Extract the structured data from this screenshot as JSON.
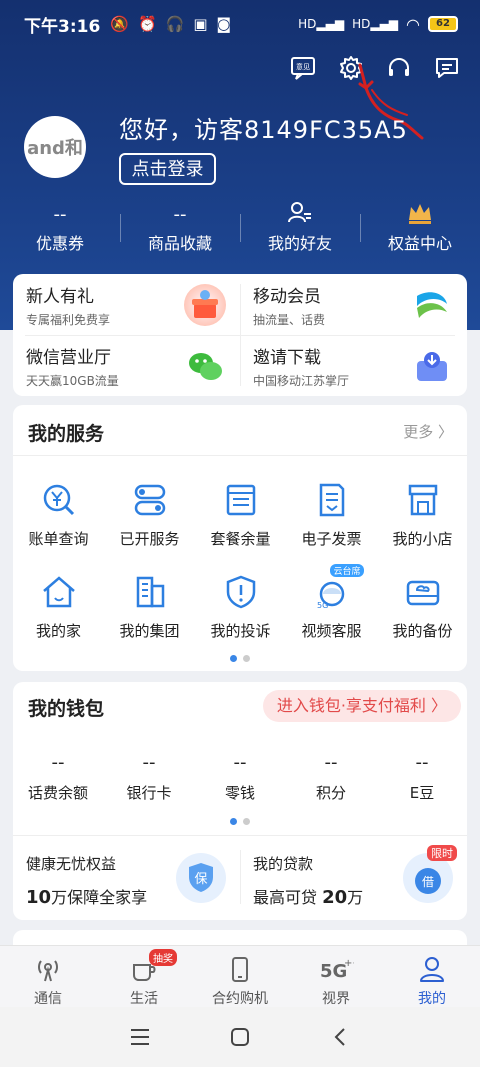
{
  "status_bar": {
    "time": "下午3:16",
    "battery": "62"
  },
  "header": {
    "greeting": "您好，访客8149FC35A5",
    "login_button": "点击登录",
    "avatar_text": "and和"
  },
  "stats": [
    {
      "value": "--",
      "label": "优惠券"
    },
    {
      "value": "--",
      "label": "商品收藏"
    },
    {
      "value": "",
      "label": "我的好友"
    },
    {
      "value": "",
      "label": "权益中心"
    }
  ],
  "promo": [
    {
      "title": "新人有礼",
      "subtitle": "专属福利免费享"
    },
    {
      "title": "移动会员",
      "subtitle": "抽流量、话费"
    },
    {
      "title": "微信营业厅",
      "subtitle": "天天赢10GB流量"
    },
    {
      "title": "邀请下载",
      "subtitle": "中国移动江苏掌厅"
    }
  ],
  "services": {
    "title": "我的服务",
    "more": "更多",
    "items": [
      {
        "label": "账单查询",
        "icon": "bill-icon"
      },
      {
        "label": "已开服务",
        "icon": "toggle-icon"
      },
      {
        "label": "套餐余量",
        "icon": "calendar-icon"
      },
      {
        "label": "电子发票",
        "icon": "invoice-icon"
      },
      {
        "label": "我的小店",
        "icon": "shop-icon"
      },
      {
        "label": "我的家",
        "icon": "home-icon"
      },
      {
        "label": "我的集团",
        "icon": "building-icon"
      },
      {
        "label": "我的投诉",
        "icon": "alert-icon"
      },
      {
        "label": "视频客服",
        "icon": "video-service-icon"
      },
      {
        "label": "我的备份",
        "icon": "cloud-backup-icon"
      }
    ],
    "video_badge": "云台席"
  },
  "wallet": {
    "title": "我的钱包",
    "pill": "进入钱包·享支付福利 〉",
    "items": [
      {
        "value": "--",
        "label": "话费余额"
      },
      {
        "value": "--",
        "label": "银行卡"
      },
      {
        "value": "--",
        "label": "零钱"
      },
      {
        "value": "--",
        "label": "积分"
      },
      {
        "value": "--",
        "label": "E豆"
      }
    ],
    "insurance": {
      "title": "健康无忧权益",
      "prefix": "10",
      "suffix": "万保障全家享",
      "icon_text": "保"
    },
    "loan": {
      "title": "我的贷款",
      "prefix": "最高可贷 ",
      "amount": "20",
      "suffix": "万",
      "icon_text": "借",
      "tag": "限时"
    }
  },
  "tabs": [
    {
      "label": "通信",
      "icon": "signal-tower-icon"
    },
    {
      "label": "生活",
      "icon": "coffee-icon",
      "badge": "抽奖"
    },
    {
      "label": "合约购机",
      "icon": "phone-icon"
    },
    {
      "label": "视界",
      "icon": "5g-icon"
    },
    {
      "label": "我的",
      "icon": "person-icon",
      "active": true
    }
  ],
  "top_actions": {
    "feedback_label": "意见"
  },
  "colors": {
    "header": "#1a3e86",
    "accent": "#3a86e6",
    "pill_text": "#e24a4a",
    "active_tab": "#2c5fd1"
  }
}
